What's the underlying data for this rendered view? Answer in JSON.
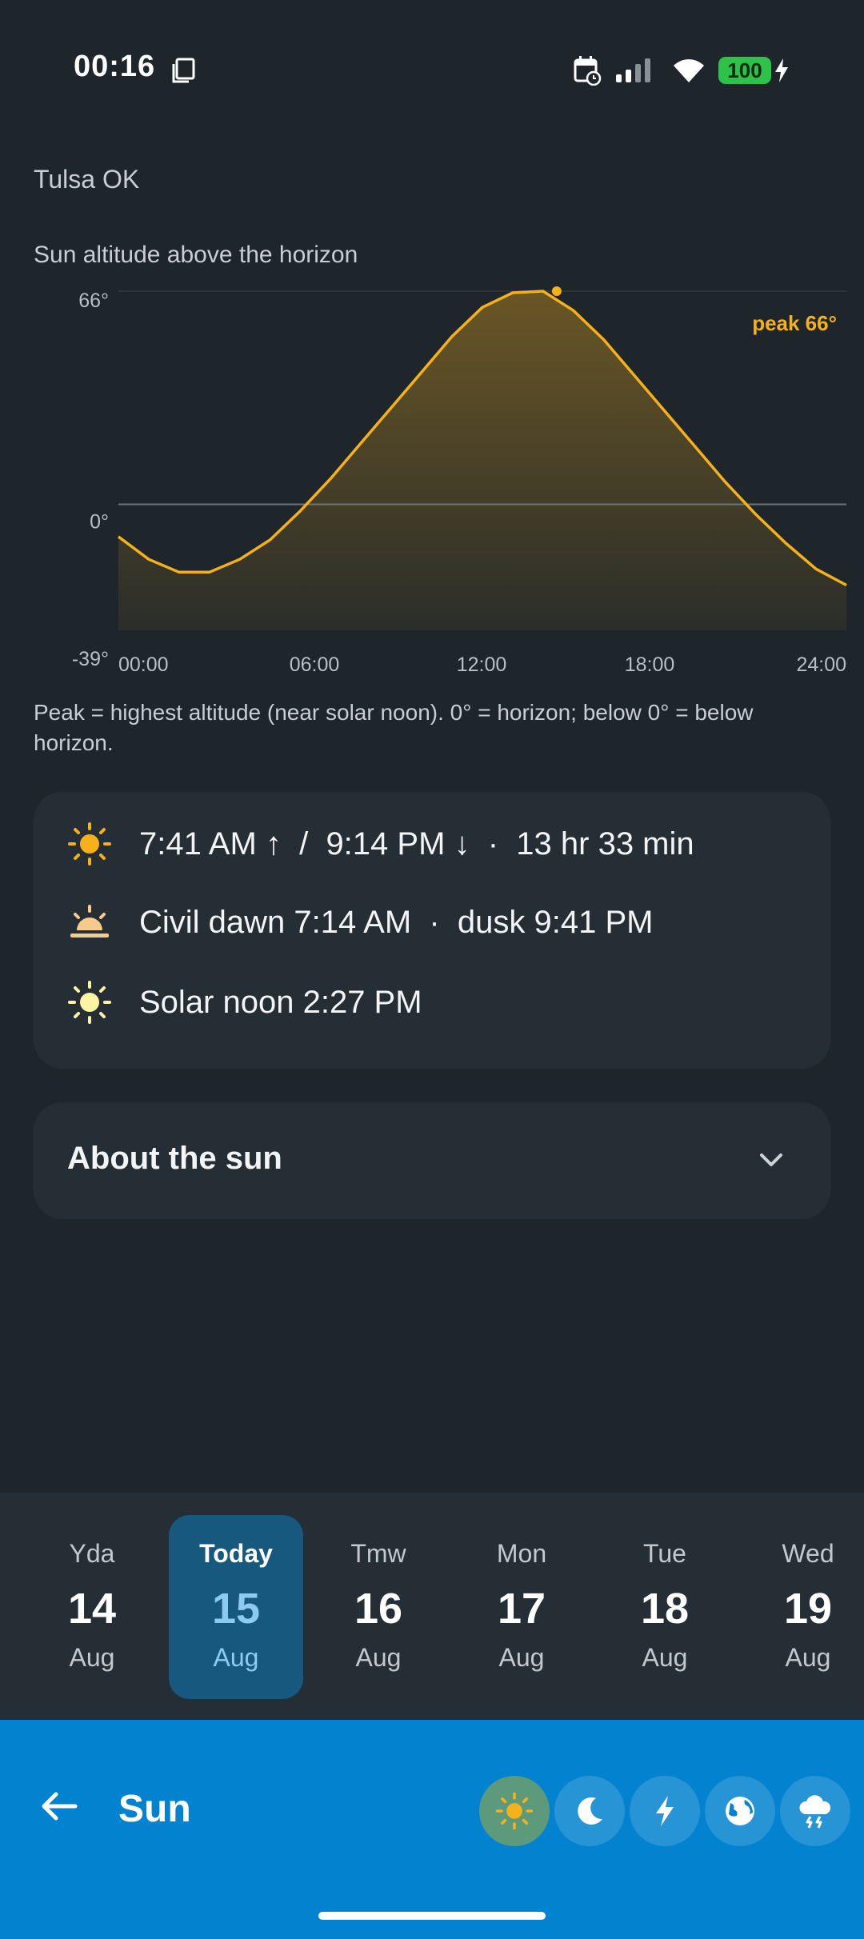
{
  "status_bar": {
    "time": "00:16",
    "battery": "100",
    "icons": [
      "screenshot-icon",
      "calendar-clock-icon",
      "signal-icon",
      "wifi-icon",
      "battery-icon",
      "charging-bolt-icon"
    ]
  },
  "location": "Tulsa OK",
  "chart_caption": "Sun altitude above the horizon",
  "chart_data": {
    "type": "area",
    "title": "",
    "xlabel": "",
    "ylabel": "",
    "x_ticks": [
      "00:00",
      "06:00",
      "12:00",
      "18:00",
      "24:00"
    ],
    "y_ticks": [
      "66°",
      "0°",
      "-39°"
    ],
    "ylim": [
      -39,
      66
    ],
    "xlim": [
      0,
      24
    ],
    "x": [
      0,
      1,
      2,
      3,
      4,
      5,
      6,
      7,
      8,
      9,
      10,
      11,
      12,
      13,
      14,
      15,
      16,
      17,
      18,
      19,
      20,
      21,
      22,
      23,
      24
    ],
    "values": [
      -10,
      -17,
      -21,
      -21,
      -17,
      -11,
      -2,
      8,
      19,
      30,
      41,
      52,
      61,
      65.5,
      66,
      60,
      51,
      40,
      29,
      18,
      7,
      -3,
      -12,
      -20,
      -25
    ],
    "peak": {
      "x": 14.45,
      "y": 66,
      "label": "peak 66°"
    },
    "grid": false,
    "colors": {
      "line": "#f5b11a",
      "fill": "#f5b11a",
      "horizon": "#6b737b"
    }
  },
  "footnote": "Peak = highest altitude (near solar noon). 0° = horizon; below 0° = below horizon.",
  "info": {
    "rise_set": "7:41 AM ↑  /  9:14 PM ↓  ·  13 hr 33 min",
    "civil": "Civil dawn 7:14 AM  ·  dusk 9:41 PM",
    "solar_noon": "Solar noon 2:27 PM"
  },
  "about": {
    "title": "About the sun"
  },
  "days": [
    {
      "name": "Yda",
      "num": "14",
      "mon": "Aug",
      "selected": false
    },
    {
      "name": "Today",
      "num": "15",
      "mon": "Aug",
      "selected": true
    },
    {
      "name": "Tmw",
      "num": "16",
      "mon": "Aug",
      "selected": false
    },
    {
      "name": "Mon",
      "num": "17",
      "mon": "Aug",
      "selected": false
    },
    {
      "name": "Tue",
      "num": "18",
      "mon": "Aug",
      "selected": false
    },
    {
      "name": "Wed",
      "num": "19",
      "mon": "Aug",
      "selected": false
    }
  ],
  "bottom_bar": {
    "title": "Sun",
    "modes": [
      "sun-icon",
      "moon-icon",
      "lightning-icon",
      "globe-icon",
      "storm-cloud-icon"
    ],
    "active_mode": "sun-icon"
  },
  "colors": {
    "background": "#1e252b",
    "card": "#262e35",
    "accent_blue": "#0383cf",
    "selected_day": "#17587f",
    "sun_yellow": "#f5b11a"
  }
}
